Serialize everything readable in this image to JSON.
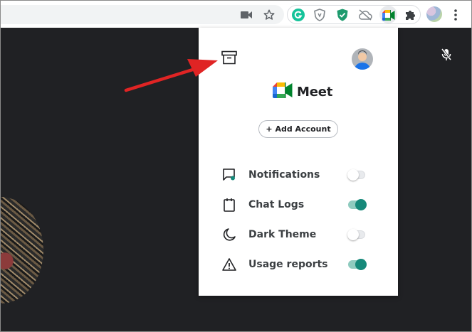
{
  "extension": {
    "brand_name": "Meet",
    "add_account_label": "+ Add Account",
    "settings": [
      {
        "label": "Notifications",
        "icon": "notification-chat-icon",
        "enabled": false
      },
      {
        "label": "Chat Logs",
        "icon": "notepad-icon",
        "enabled": true
      },
      {
        "label": "Dark Theme",
        "icon": "moon-icon",
        "enabled": false
      },
      {
        "label": "Usage reports",
        "icon": "warning-icon",
        "enabled": true
      }
    ]
  },
  "colors": {
    "toggle_on": "#16897a",
    "toggle_track_on": "#8fcbbf",
    "annotation_arrow": "#e02424",
    "meet_background": "#202124"
  },
  "toolbar_icons": [
    "camera-icon",
    "star-icon",
    "grammarly-icon",
    "shield-extension-icon",
    "green-shield-extension-icon",
    "cloud-off-icon",
    "google-meet-extension-icon",
    "puzzle-icon",
    "profile-avatar",
    "more-vert-icon"
  ]
}
